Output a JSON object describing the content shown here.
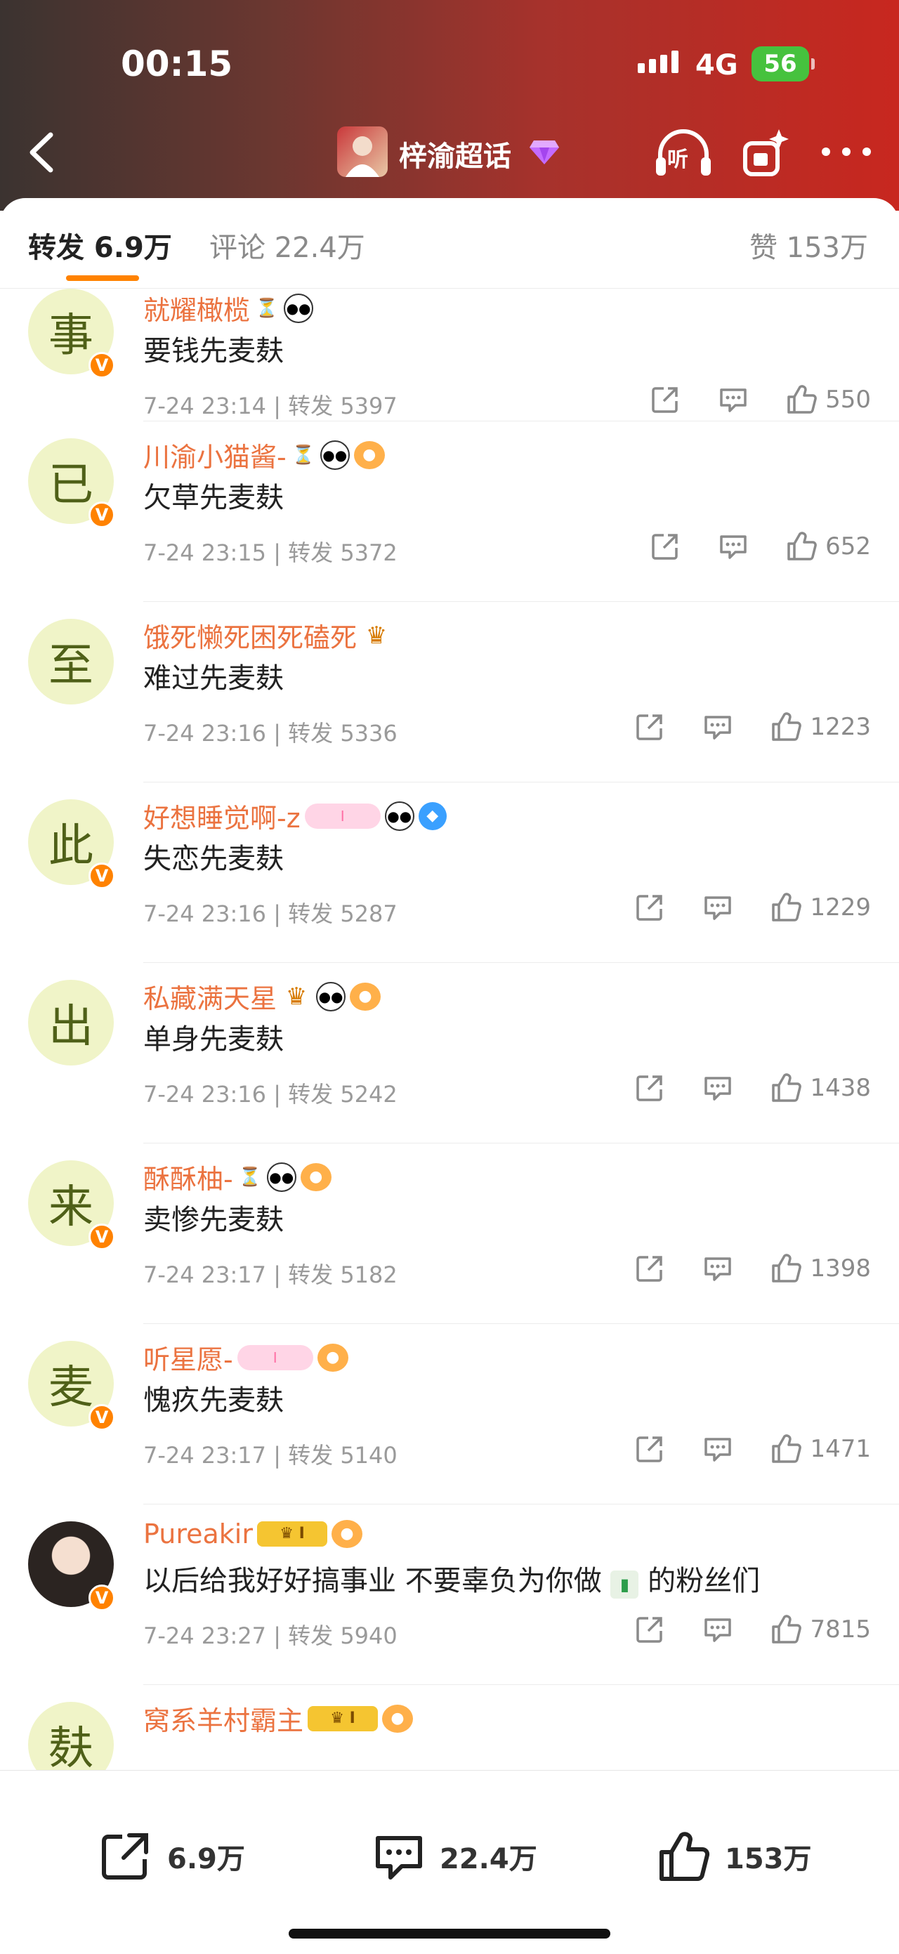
{
  "status_bar": {
    "time": "00:15",
    "network": "4G",
    "battery": "56"
  },
  "nav": {
    "title": "梓渝超话",
    "listen_label": "听"
  },
  "tabs": {
    "repost": "转发 6.9万",
    "comment": "评论 22.4万",
    "like": "赞 153万"
  },
  "colors": {
    "accent": "#ff8200",
    "username": "#eb7340",
    "header_red": "#c8271f"
  },
  "items": [
    {
      "avatar": "事",
      "name": "就耀橄榄",
      "text": "要钱先麦麸",
      "meta": "7-24 23:14 | 转发 5397",
      "likes": "550"
    },
    {
      "avatar": "已",
      "name": "川渝小猫酱-",
      "text": "欠草先麦麸",
      "meta": "7-24 23:15 | 转发 5372",
      "likes": "652"
    },
    {
      "avatar": "至",
      "name": "饿死懒死困死磕死",
      "text": "难过先麦麸",
      "meta": "7-24 23:16 | 转发 5336",
      "likes": "1223"
    },
    {
      "avatar": "此",
      "name": "好想睡觉啊-z",
      "text": "失恋先麦麸",
      "meta": "7-24 23:16 | 转发 5287",
      "likes": "1229"
    },
    {
      "avatar": "出",
      "name": "私藏满天星",
      "text": "单身先麦麸",
      "meta": "7-24 23:16 | 转发 5242",
      "likes": "1438"
    },
    {
      "avatar": "来",
      "name": "酥酥柚-",
      "text": "卖惨先麦麸",
      "meta": "7-24 23:17 | 转发 5182",
      "likes": "1398"
    },
    {
      "avatar": "麦",
      "name": "听星愿-",
      "text": "愧疚先麦麸",
      "meta": "7-24 23:17 | 转发 5140",
      "likes": "1471"
    },
    {
      "avatar": "",
      "name": "Pureakir",
      "text": "以后给我好好搞事业 不要辜负为你做",
      "text_after": "的粉丝们",
      "meta": "7-24 23:27 | 转发 5940",
      "likes": "7815"
    },
    {
      "avatar": "麸",
      "name": "窝系羊村霸主",
      "text": "",
      "meta": "",
      "likes": ""
    }
  ],
  "bottom_bar": {
    "repost": "6.9万",
    "comment": "22.4万",
    "like": "153万"
  },
  "icons": [
    "back-icon",
    "headphones-icon",
    "gift-icon",
    "more-icon",
    "repost-icon",
    "comment-icon",
    "like-icon",
    "vip-badge-icon"
  ]
}
